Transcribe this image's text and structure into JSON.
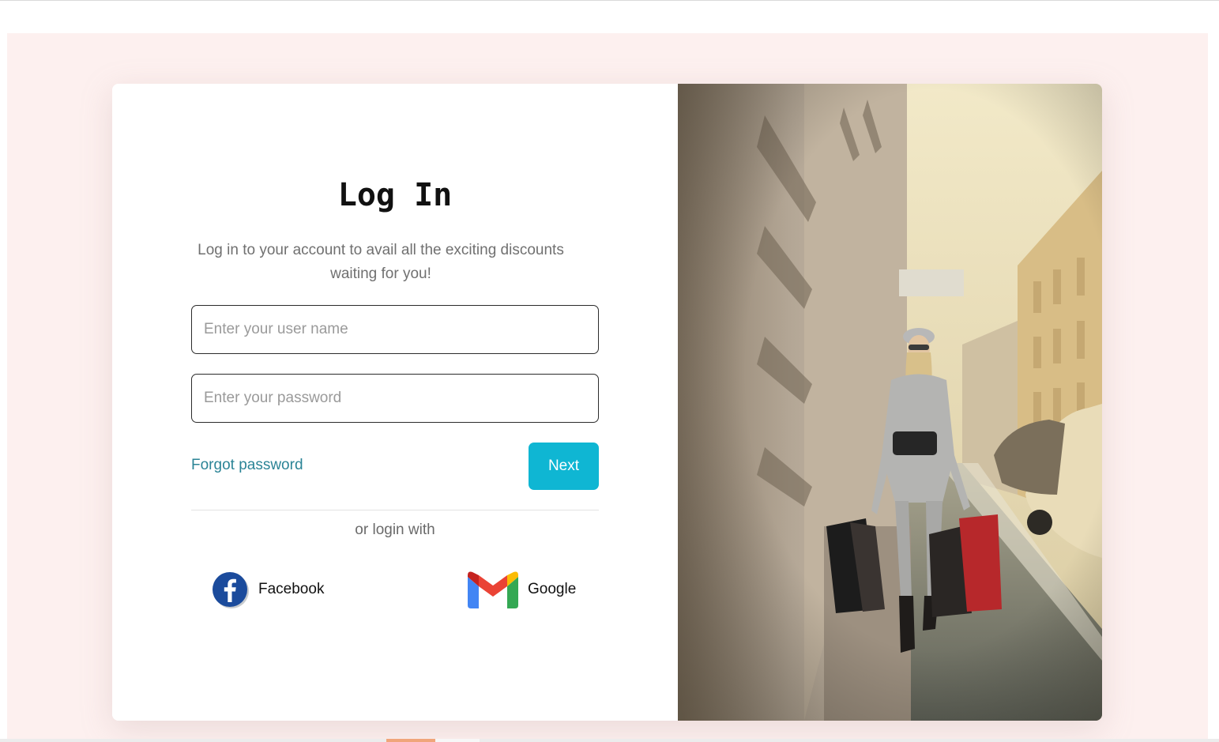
{
  "login": {
    "title": "Log In",
    "subtitle": "Log in to your account to avail all the exciting discounts waiting for you!",
    "username_placeholder": "Enter your user name",
    "password_placeholder": "Enter your password",
    "forgot_label": "Forgot password",
    "next_label": "Next",
    "or_label": "or login with"
  },
  "social": [
    {
      "label": "Facebook",
      "icon": "facebook-icon",
      "color": "#1877f2"
    },
    {
      "label": "Google",
      "icon": "gmail-icon",
      "color": "#ea4335"
    }
  ],
  "hero": {
    "icon": "shopping-woman-photo"
  },
  "colors": {
    "page_background": "#fdf0ef",
    "accent": "#0fb6d3",
    "link": "#2b8496"
  }
}
